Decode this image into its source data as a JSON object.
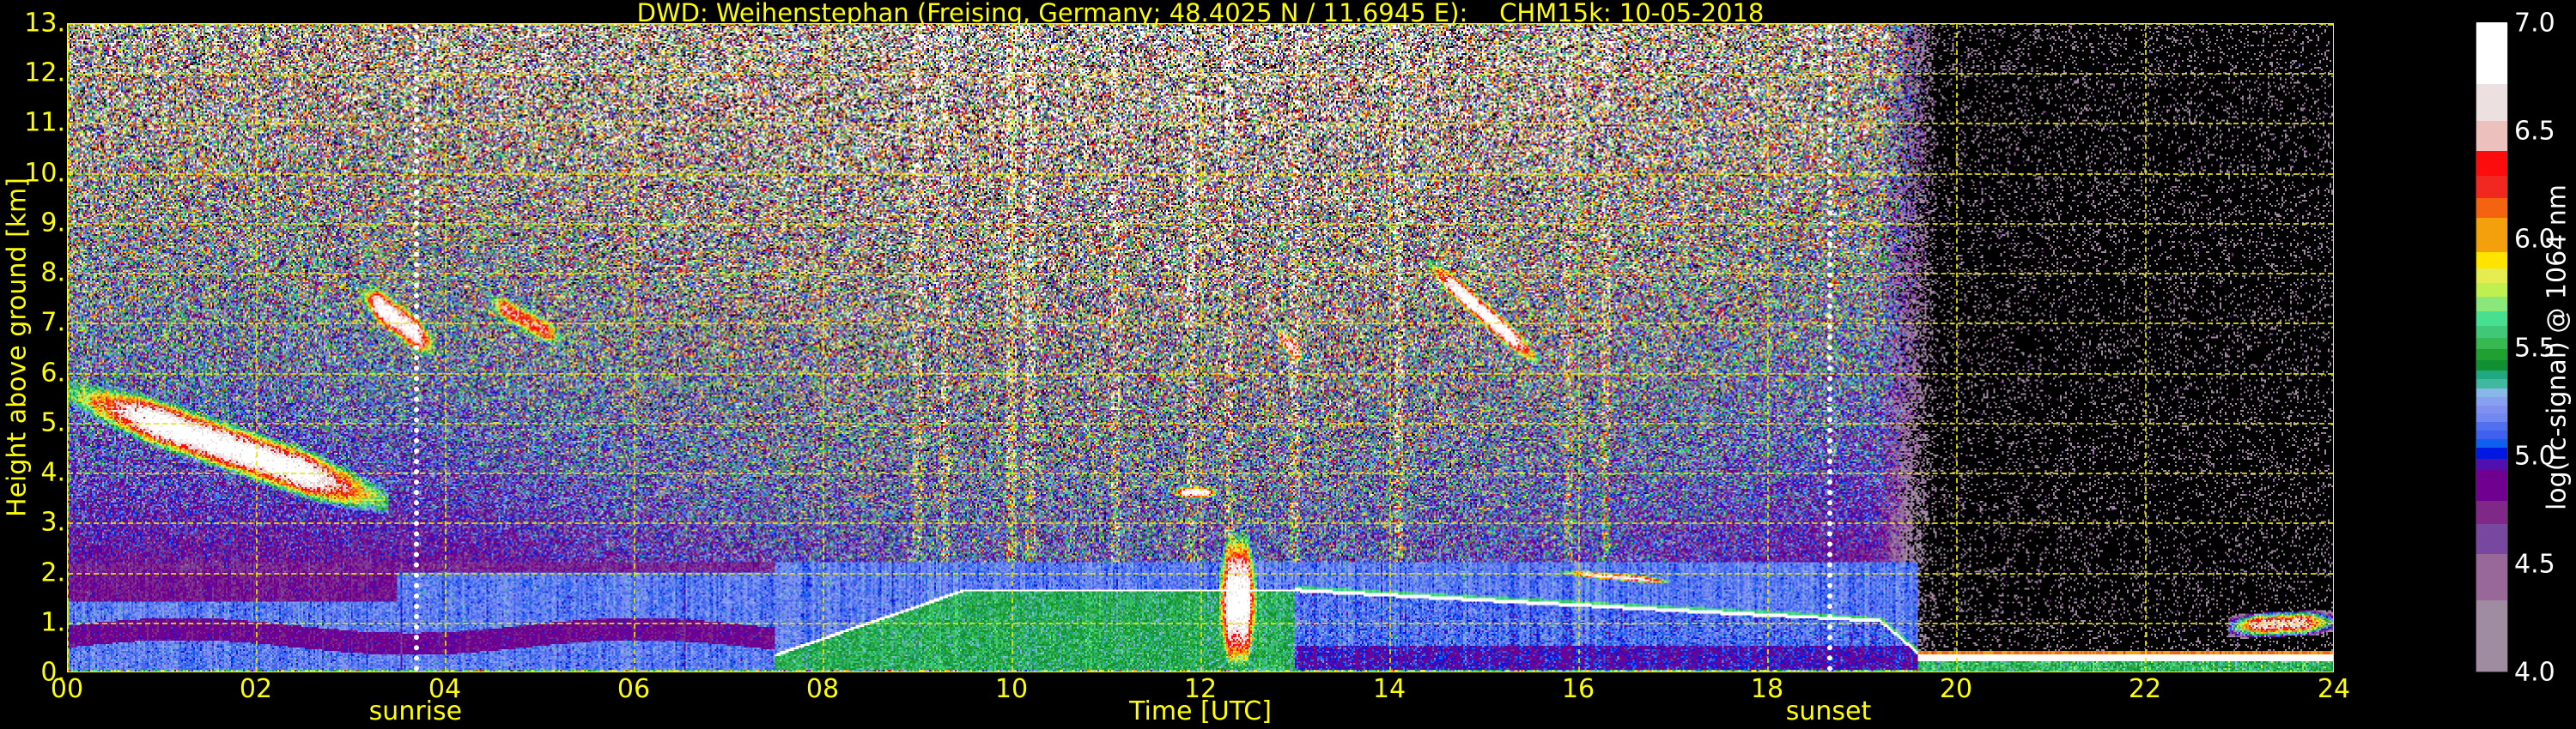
{
  "chart_data": {
    "type": "heatmap",
    "title": "DWD: Weihenstephan (Freising, Germany; 48.4025 N / 11.6945 E):    CHM15k: 10-05-2018",
    "xlabel": "Time [UTC]",
    "ylabel": "Height above ground [km]",
    "xlim": [
      0,
      24
    ],
    "ylim": [
      0,
      13
    ],
    "x_ticks": [
      0,
      2,
      4,
      6,
      8,
      10,
      12,
      14,
      16,
      18,
      20,
      22,
      24
    ],
    "x_tick_labels": [
      "00",
      "02",
      "04",
      "06",
      "08",
      "10",
      "12",
      "14",
      "16",
      "18",
      "20",
      "22",
      "24"
    ],
    "y_ticks": [
      0,
      1,
      2,
      3,
      4,
      5,
      6,
      7,
      8,
      9,
      10,
      11,
      12,
      13
    ],
    "y_tick_labels": [
      "0.",
      "1.",
      "2.",
      "3.",
      "4.",
      "5.",
      "6.",
      "7.",
      "8.",
      "9.",
      "10.",
      "11.",
      "12.",
      "13."
    ],
    "grid": true,
    "annotations": [
      {
        "label": "sunrise",
        "x": 3.69
      },
      {
        "label": "sunset",
        "x": 18.65
      }
    ],
    "colorbar": {
      "label": "log(rc-signal) @ 1064 nm",
      "range": [
        4.0,
        7.0
      ],
      "ticks": [
        4.0,
        4.5,
        5.0,
        5.5,
        6.0,
        6.5,
        7.0
      ],
      "tick_labels": [
        "4.0",
        "4.5",
        "5.0",
        "5.5",
        "6.0",
        "6.5",
        "7.0"
      ],
      "below_color": "#000000",
      "segments": [
        {
          "from": 4.0,
          "to": 4.33,
          "color": "#a08ca0"
        },
        {
          "from": 4.33,
          "to": 4.544,
          "color": "#986898"
        },
        {
          "from": 4.544,
          "to": 4.682,
          "color": "#7848a0"
        },
        {
          "from": 4.682,
          "to": 4.789,
          "color": "#802888"
        },
        {
          "from": 4.789,
          "to": 4.93,
          "color": "#700090"
        },
        {
          "from": 4.93,
          "to": 4.981,
          "color": "#5010b0"
        },
        {
          "from": 4.981,
          "to": 5.033,
          "color": "#0018e0"
        },
        {
          "from": 5.033,
          "to": 5.076,
          "color": "#1060f0"
        },
        {
          "from": 5.076,
          "to": 5.114,
          "color": "#4060f0"
        },
        {
          "from": 5.114,
          "to": 5.153,
          "color": "#5070f0"
        },
        {
          "from": 5.153,
          "to": 5.191,
          "color": "#7088f0"
        },
        {
          "from": 5.191,
          "to": 5.23,
          "color": "#8090f0"
        },
        {
          "from": 5.23,
          "to": 5.269,
          "color": "#88a0f0"
        },
        {
          "from": 5.269,
          "to": 5.307,
          "color": "#88b8e8"
        },
        {
          "from": 5.307,
          "to": 5.35,
          "color": "#40b8a0"
        },
        {
          "from": 5.35,
          "to": 5.393,
          "color": "#20a880"
        },
        {
          "from": 5.393,
          "to": 5.44,
          "color": "#109030"
        },
        {
          "from": 5.44,
          "to": 5.491,
          "color": "#20a030"
        },
        {
          "from": 5.491,
          "to": 5.543,
          "color": "#38b850"
        },
        {
          "from": 5.543,
          "to": 5.599,
          "color": "#40c878"
        },
        {
          "from": 5.599,
          "to": 5.663,
          "color": "#48e090"
        },
        {
          "from": 5.663,
          "to": 5.731,
          "color": "#8ae87a"
        },
        {
          "from": 5.731,
          "to": 5.796,
          "color": "#c0f050"
        },
        {
          "from": 5.796,
          "to": 5.864,
          "color": "#e4ec50"
        },
        {
          "from": 5.864,
          "to": 5.937,
          "color": "#ffe400"
        },
        {
          "from": 5.937,
          "to": 6.096,
          "color": "#f4a00c"
        },
        {
          "from": 6.096,
          "to": 6.186,
          "color": "#f46410"
        },
        {
          "from": 6.186,
          "to": 6.289,
          "color": "#f02820"
        },
        {
          "from": 6.289,
          "to": 6.404,
          "color": "#fc0c0c"
        },
        {
          "from": 6.404,
          "to": 6.546,
          "color": "#ecc0bc"
        },
        {
          "from": 6.546,
          "to": 6.715,
          "color": "#ece0e0"
        },
        {
          "from": 6.715,
          "to": 7.0,
          "color": "#ffffff"
        }
      ]
    },
    "features": [
      {
        "name": "mid-level cloud (night)",
        "t0": 0.0,
        "t1": 3.4,
        "h_start": 5.6,
        "h_end": 3.4,
        "thickness": 1.0,
        "peak": 7.0
      },
      {
        "name": "cloud after sunrise",
        "t0": 3.1,
        "t1": 3.9,
        "h_start": 7.6,
        "h_end": 6.5,
        "thickness": 0.8,
        "peak": 6.9
      },
      {
        "name": "thin cloud",
        "t0": 4.4,
        "t1": 5.3,
        "h_start": 7.5,
        "h_end": 6.6,
        "thickness": 0.6,
        "peak": 6.4
      },
      {
        "name": "cirrus afternoon",
        "t0": 14.4,
        "t1": 15.6,
        "h_start": 8.2,
        "h_end": 6.2,
        "thickness": 0.55,
        "peak": 7.0
      },
      {
        "name": "cloud 13h",
        "t0": 12.8,
        "t1": 13.1,
        "h_start": 6.8,
        "h_end": 6.3,
        "thickness": 0.5,
        "peak": 6.6
      },
      {
        "name": "convective column",
        "t0": 12.2,
        "t1": 12.6,
        "h_start": 1.4,
        "h_end": 1.4,
        "thickness": 2.8,
        "peak": 7.0
      },
      {
        "name": "cumulus 12h",
        "t0": 11.7,
        "t1": 12.2,
        "h_start": 3.6,
        "h_end": 3.6,
        "thickness": 0.25,
        "peak": 6.9
      },
      {
        "name": "cumulus 16h",
        "t0": 15.8,
        "t1": 17.0,
        "h_start": 2.0,
        "h_end": 1.8,
        "thickness": 0.15,
        "peak": 6.8
      },
      {
        "name": "low cloud late",
        "t0": 22.9,
        "t1": 24.0,
        "h_start": 0.9,
        "h_end": 1.0,
        "thickness": 0.5,
        "peak": 6.6
      }
    ],
    "streak_hours": [
      9.0,
      9.3,
      10.0,
      10.2,
      11.1,
      11.9,
      12.3,
      13.0,
      14.1,
      15.9,
      16.3
    ]
  }
}
